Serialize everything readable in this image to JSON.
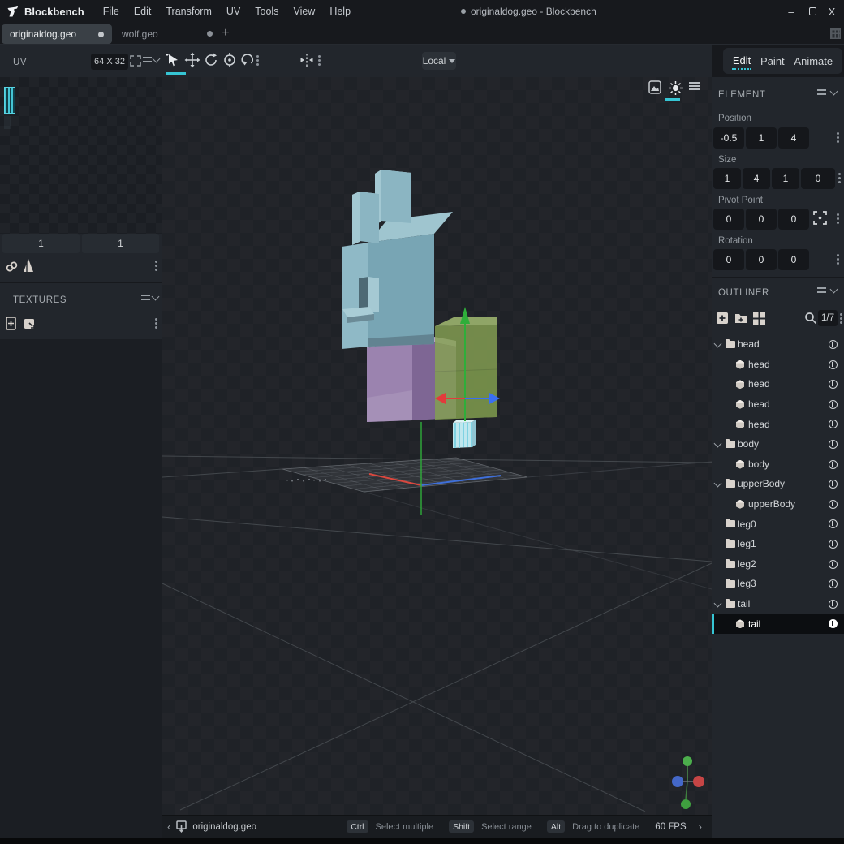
{
  "window": {
    "title": "originaldog.geo - Blockbench",
    "controls": {
      "minimize": "–",
      "close": "X"
    }
  },
  "menu": {
    "app": "Blockbench",
    "items": [
      "File",
      "Edit",
      "Transform",
      "UV",
      "Tools",
      "View",
      "Help"
    ]
  },
  "tabs": {
    "active": "originaldog.geo",
    "inactive": "wolf.geo",
    "new_tab": "+"
  },
  "uv_panel": {
    "title": "UV",
    "size_label": "64 X 32",
    "slider1": "1",
    "slider2": "1"
  },
  "textures_panel": {
    "title": "TEXTURES"
  },
  "viewport_toolbar": {
    "local_label": "Local"
  },
  "modes": [
    "Edit",
    "Paint",
    "Animate"
  ],
  "element_panel": {
    "title": "ELEMENT",
    "position_label": "Position",
    "position": [
      "-0.5",
      "1",
      "4"
    ],
    "size_label": "Size",
    "size": [
      "1",
      "4",
      "1",
      "0"
    ],
    "pivot_label": "Pivot Point",
    "pivot": [
      "0",
      "0",
      "0"
    ],
    "rotation_label": "Rotation",
    "rotation": [
      "0",
      "0",
      "0"
    ]
  },
  "outliner": {
    "title": "OUTLINER",
    "counter": "1/7",
    "rows": [
      {
        "label": "head",
        "type": "folder",
        "expanded": true
      },
      {
        "label": "head",
        "type": "cube"
      },
      {
        "label": "head",
        "type": "cube"
      },
      {
        "label": "head",
        "type": "cube"
      },
      {
        "label": "head",
        "type": "cube"
      },
      {
        "label": "body",
        "type": "folder",
        "expanded": true
      },
      {
        "label": "body",
        "type": "cube"
      },
      {
        "label": "upperBody",
        "type": "folder",
        "expanded": true
      },
      {
        "label": "upperBody",
        "type": "cube"
      },
      {
        "label": "leg0",
        "type": "folder"
      },
      {
        "label": "leg1",
        "type": "folder"
      },
      {
        "label": "leg2",
        "type": "folder"
      },
      {
        "label": "leg3",
        "type": "folder"
      },
      {
        "label": "tail",
        "type": "folder",
        "expanded": true
      },
      {
        "label": "tail",
        "type": "cube",
        "selected": true
      }
    ]
  },
  "statusbar": {
    "prev": "‹",
    "next": "›",
    "filename": "originaldog.geo",
    "hints": [
      {
        "key": "Ctrl",
        "text": "Select multiple"
      },
      {
        "key": "Shift",
        "text": "Select range"
      },
      {
        "key": "Alt",
        "text": "Drag to duplicate"
      }
    ],
    "fps": "60 FPS"
  },
  "colors": {
    "accent": "#36c5d4",
    "panel_bg": "#22262c",
    "dark_bg": "#17191d",
    "viewport_bg": "#1f2227",
    "head_teal": "#78a5b4",
    "body_purple": "#7e6694",
    "upper_body_green": "#87a253",
    "axis_x_red": "#e23b3b",
    "axis_y_green": "#2fae3a",
    "axis_z_blue": "#3a6ff2"
  }
}
